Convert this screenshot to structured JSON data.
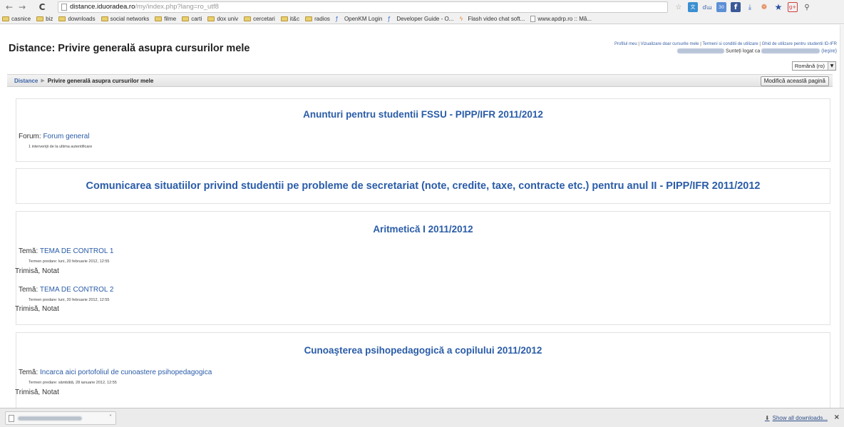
{
  "browser": {
    "back_icon": "←",
    "forward_icon": "→",
    "reload_icon": "C",
    "url_host": "distance.iduoradea.ro",
    "url_path": "/my/index.php?lang=ro_utf8",
    "bookmarks": [
      "casnice",
      "biz",
      "downloads",
      "social networks",
      "filme",
      "carti",
      "dox univ",
      "cercetari",
      "it&c",
      "radios"
    ],
    "bookmark_links": [
      "OpenKM Login",
      "Developer Guide - O...",
      "Flash video chat soft...",
      "www.apdrp.ro :: Mă..."
    ]
  },
  "header": {
    "title": "Distance: Privire generală asupra cursurilor mele",
    "links": [
      "Profilul meu",
      "Vizualizare doar cursurile mele",
      "Termeni si conditii de utilizare",
      "Ghid de utilizare pentru studentii ID-IFR"
    ],
    "logged_in_text": "Sunteți logat ca",
    "logout_text": "(Ieşire)",
    "language": "Română (ro)"
  },
  "navbar": {
    "home": "Distance",
    "current": "Privire generală asupra cursurilor mele",
    "edit_button": "Modifică această pagină"
  },
  "courses": [
    {
      "title": "Anunturi pentru studentii FSSU - PIPP/IFR 2011/2012",
      "forum_label": "Forum:",
      "forum_link": "Forum general",
      "forum_note": "1 intervenţii de la ultima autentificare"
    },
    {
      "title": "Comunicarea situatiilor privind studentii pe probleme de secretariat (note, credite, taxe, contracte etc.) pentru anul II - PIPP/IFR 2011/2012"
    },
    {
      "title": "Aritmetică I 2011/2012",
      "items": [
        {
          "label": "Temă:",
          "link": "TEMA DE CONTROL 1",
          "deadline": "Termen predare: luni, 20 februarie 2012, 12:55",
          "status": "Trimisă, Notat"
        },
        {
          "label": "Temă:",
          "link": "TEMA DE CONTROL 2",
          "deadline": "Termen predare: luni, 20 februarie 2012, 12:55",
          "status": "Trimisă, Notat"
        }
      ]
    },
    {
      "title": "Cunoaşterea psihopedagogică a copilului 2011/2012",
      "items": [
        {
          "label": "Temă:",
          "link": "Incarca aici portofoliul de cunoastere psihopedagogica",
          "deadline": "Termen predare: sâmbătă, 28 ianuarie 2012, 12:55",
          "status": "Trimisă, Notat"
        }
      ]
    }
  ],
  "downloads": {
    "show_all": "Show all downloads...",
    "close": "×"
  },
  "colors": {
    "link": "#2a5ca8",
    "folder": "#e9cf6e"
  }
}
